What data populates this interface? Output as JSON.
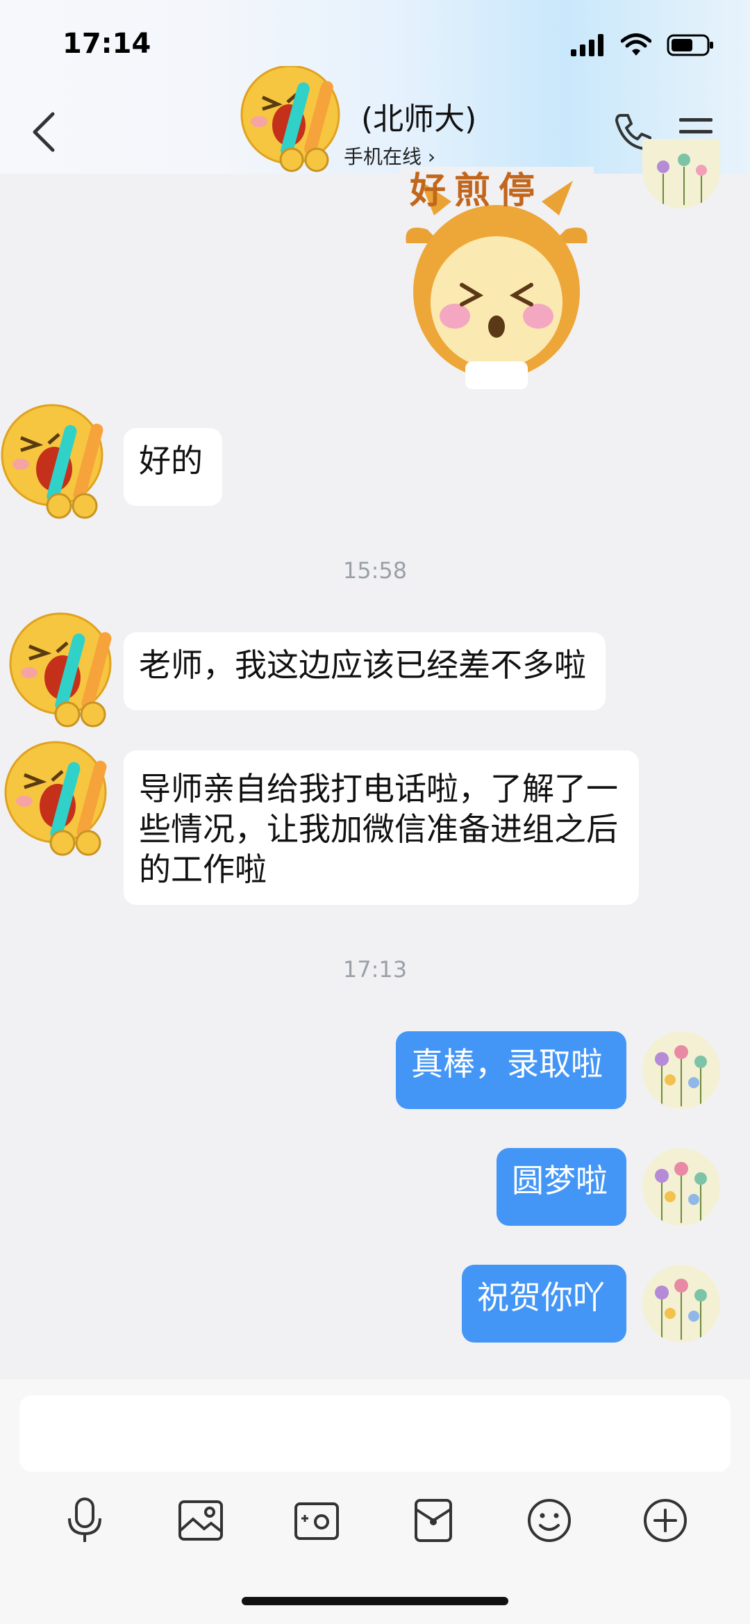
{
  "status": {
    "time": "17:14"
  },
  "header": {
    "title": "(北师大)",
    "subtitle": "手机在线 ›"
  },
  "sticker": {
    "text": "好煎停"
  },
  "timestamps": [
    "15:58",
    "17:13"
  ],
  "messages_in": [
    {
      "text": "好的"
    },
    {
      "text": "老师，我这边应该已经差不多啦"
    },
    {
      "line1": "导师亲自给我打电话啦，了解了一",
      "line2": "些情况，让我加微信准备进组之后",
      "line3": "的工作啦"
    }
  ],
  "messages_out": [
    {
      "text": "真棒，录取啦"
    },
    {
      "text": "圆梦啦"
    },
    {
      "text": "祝贺你吖"
    }
  ],
  "toolbar": {
    "icons": [
      "microphone-icon",
      "photo-icon",
      "camera-icon",
      "red-packet-icon",
      "emoji-icon",
      "plus-icon"
    ]
  },
  "colors": {
    "accent": "#4496f6",
    "background": "#f1f1f3"
  }
}
